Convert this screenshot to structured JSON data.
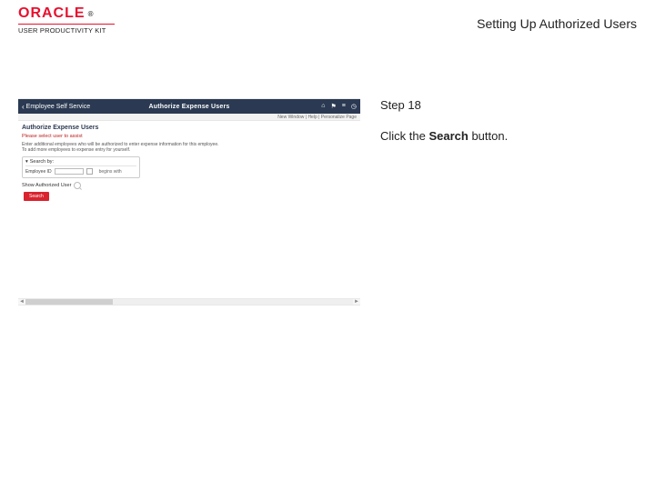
{
  "header": {
    "brand": "ORACLE",
    "trademark": "®",
    "subbrand": "USER PRODUCTIVITY KIT",
    "topic_title": "Setting Up Authorized Users"
  },
  "instruction": {
    "step_label": "Step 18",
    "text_before": "Click the ",
    "bold_word": "Search",
    "text_after": " button."
  },
  "mini": {
    "back_label": "Employee Self Service",
    "nav_title": "Authorize Expense Users",
    "subbar_text": "New Window | Help | Personalize Page",
    "page_title": "Authorize Expense Users",
    "red_sub": "Please select user to assist",
    "hint_line1": "Enter additional employees who will be authorized to enter expense information for this employee.",
    "hint_line2": "To add more employees to expense entry for yourself.",
    "search_legend": "Search by:",
    "field_label": "Employee ID",
    "ops_label": "begins with",
    "result_label": "Show Authorized User",
    "red_button_label": "Search"
  }
}
